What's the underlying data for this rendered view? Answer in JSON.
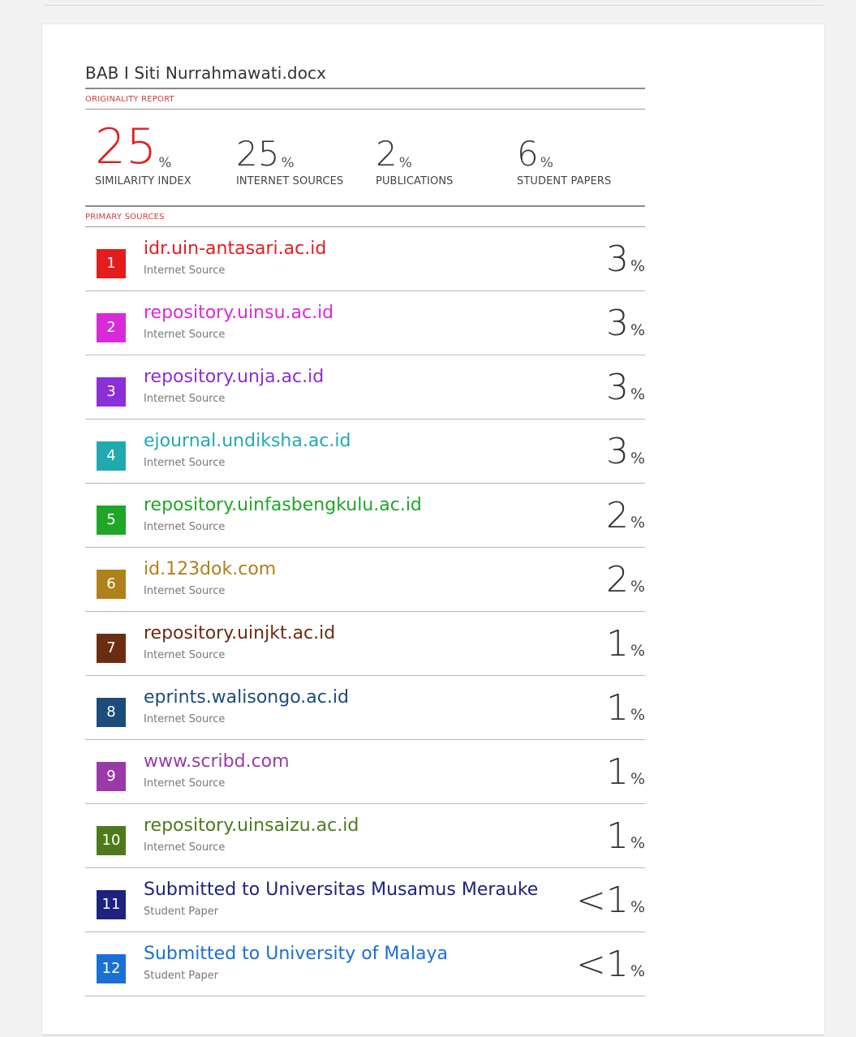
{
  "document": {
    "title": "BAB I Siti Nurrahmawati.docx",
    "originality_label": "ORIGINALITY REPORT",
    "primary_sources_label": "PRIMARY SOURCES"
  },
  "stats": [
    {
      "value": "25",
      "unit": "%",
      "caption": "SIMILARITY INDEX"
    },
    {
      "value": "25",
      "unit": "%",
      "caption": "INTERNET SOURCES"
    },
    {
      "value": "2",
      "unit": "%",
      "caption": "PUBLICATIONS"
    },
    {
      "value": "6",
      "unit": "%",
      "caption": "STUDENT PAPERS"
    }
  ],
  "sources": [
    {
      "rank": "1",
      "name": "idr.uin-antasari.ac.id",
      "type": "Internet Source",
      "share": "3",
      "unit": "%",
      "color": "#e51c1c"
    },
    {
      "rank": "2",
      "name": "repository.uinsu.ac.id",
      "type": "Internet Source",
      "share": "3",
      "unit": "%",
      "color": "#d82ad8"
    },
    {
      "rank": "3",
      "name": "repository.unja.ac.id",
      "type": "Internet Source",
      "share": "3",
      "unit": "%",
      "color": "#8b2fd6"
    },
    {
      "rank": "4",
      "name": "ejournal.undiksha.ac.id",
      "type": "Internet Source",
      "share": "3",
      "unit": "%",
      "color": "#22a9b0"
    },
    {
      "rank": "5",
      "name": "repository.uinfasbengkulu.ac.id",
      "type": "Internet Source",
      "share": "2",
      "unit": "%",
      "color": "#1fa628"
    },
    {
      "rank": "6",
      "name": "id.123dok.com",
      "type": "Internet Source",
      "share": "2",
      "unit": "%",
      "color": "#b0801a"
    },
    {
      "rank": "7",
      "name": "repository.uinjkt.ac.id",
      "type": "Internet Source",
      "share": "1",
      "unit": "%",
      "color": "#6b2d12"
    },
    {
      "rank": "8",
      "name": "eprints.walisongo.ac.id",
      "type": "Internet Source",
      "share": "1",
      "unit": "%",
      "color": "#1b4c7a"
    },
    {
      "rank": "9",
      "name": "www.scribd.com",
      "type": "Internet Source",
      "share": "1",
      "unit": "%",
      "color": "#9a3aa8"
    },
    {
      "rank": "10",
      "name": "repository.uinsaizu.ac.id",
      "type": "Internet Source",
      "share": "1",
      "unit": "%",
      "color": "#4f7a1c"
    },
    {
      "rank": "11",
      "name": "Submitted to Universitas Musamus Merauke",
      "type": "Student Paper",
      "share": "<1",
      "unit": "%",
      "color": "#1e237f"
    },
    {
      "rank": "12",
      "name": "Submitted to University of Malaya",
      "type": "Student Paper",
      "share": "<1",
      "unit": "%",
      "color": "#1a6fd6"
    }
  ]
}
